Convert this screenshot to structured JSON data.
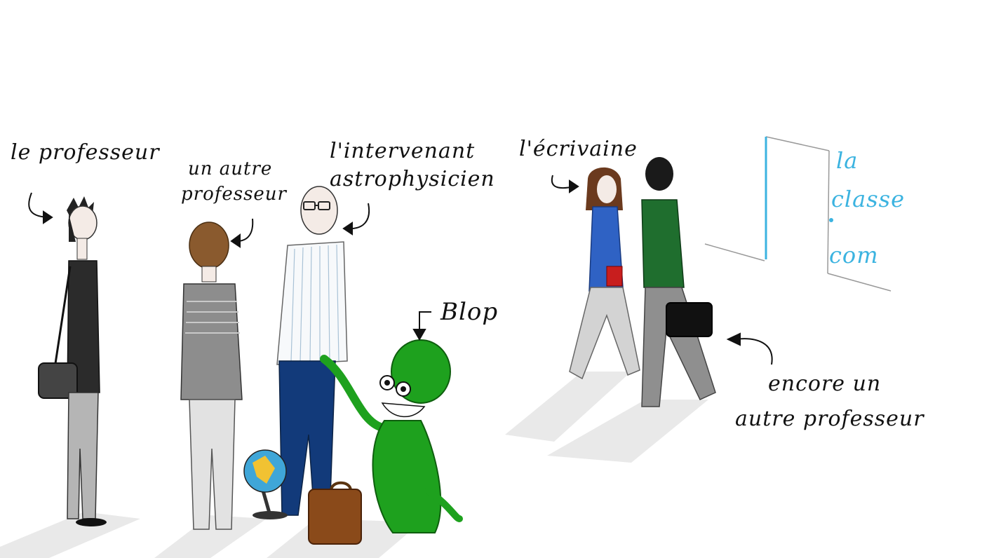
{
  "labels": {
    "teacher": "le professeur",
    "other_teacher_line1": "un autre",
    "other_teacher_line2": "professeur",
    "speaker_line1": "l'intervenant",
    "speaker_line2": "astrophysicien",
    "alien": "Blop",
    "writer": "l'écrivaine",
    "yet_another_line1": "encore un",
    "yet_another_line2": "autre professeur"
  },
  "door_sign": {
    "line1": "la",
    "line2": "classe",
    "line3": "com"
  },
  "colors": {
    "ink": "#111111",
    "door_accent": "#3bb3e0",
    "alien_green": "#1ea11e",
    "writer_sweater": "#2f62c4",
    "green_sweater": "#1f6e2e",
    "trousers_navy": "#123a7a",
    "shadow": "#e6e6e6"
  }
}
